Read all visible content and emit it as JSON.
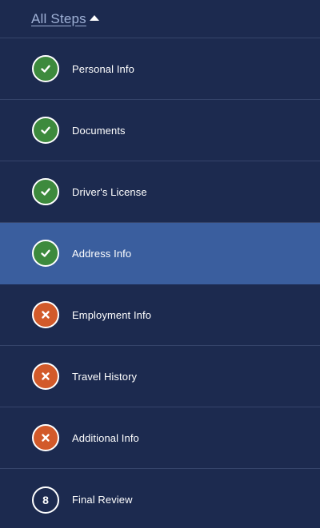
{
  "header": {
    "label": "All Steps",
    "icon": "caret-up-icon"
  },
  "colors": {
    "background": "#1c2a4f",
    "active": "#3a5e9e",
    "complete": "#3d8a3d",
    "error": "#d25a2a",
    "divider": "#35446a"
  },
  "steps": [
    {
      "label": "Personal Info",
      "status": "complete",
      "icon": "check-icon"
    },
    {
      "label": "Documents",
      "status": "complete",
      "icon": "check-icon"
    },
    {
      "label": "Driver's License",
      "status": "complete",
      "icon": "check-icon"
    },
    {
      "label": "Address Info",
      "status": "complete",
      "icon": "check-icon",
      "active": true
    },
    {
      "label": "Employment Info",
      "status": "error",
      "icon": "close-icon"
    },
    {
      "label": "Travel History",
      "status": "error",
      "icon": "close-icon"
    },
    {
      "label": "Additional Info",
      "status": "error",
      "icon": "close-icon"
    },
    {
      "label": "Final Review",
      "status": "pending",
      "number": "8"
    }
  ]
}
